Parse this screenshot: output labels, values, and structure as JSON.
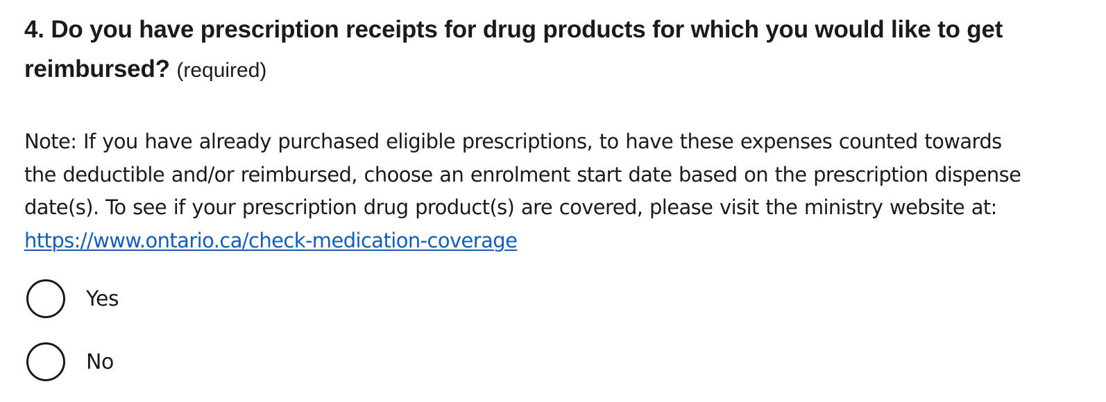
{
  "question": {
    "number_and_text": "4. Do you have prescription receipts for drug products for which you would like to get reimbursed?",
    "required_label": "(required)"
  },
  "note": {
    "text": "Note: If you have already purchased eligible prescriptions, to have these expenses counted towards the deductible and/or reimbursed, choose an enrolment start date based on the prescription dispense date(s). To see if your prescription drug product(s) are covered, please visit the ministry website at: ",
    "link_text": "https://www.ontario.ca/check-medication-coverage",
    "link_color": "#0b5fcc"
  },
  "options": [
    {
      "label": "Yes",
      "selected": false
    },
    {
      "label": "No",
      "selected": false
    }
  ]
}
